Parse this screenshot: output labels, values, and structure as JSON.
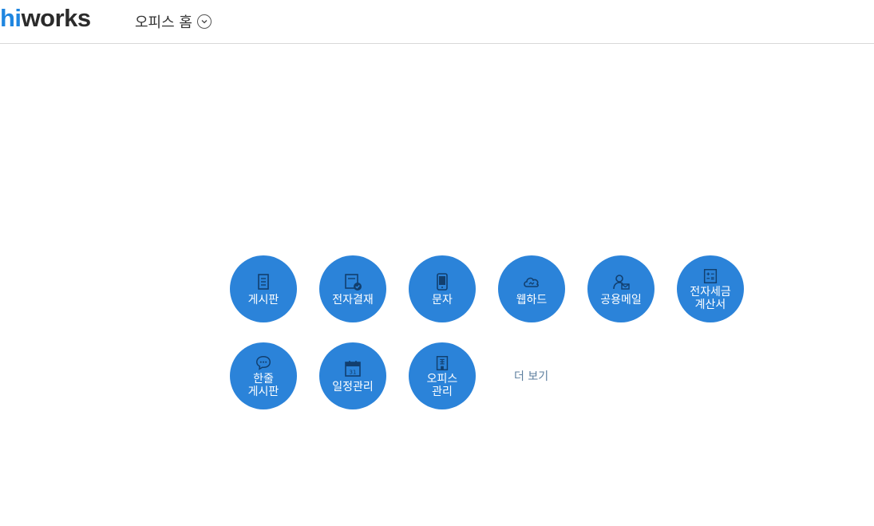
{
  "header": {
    "logo_hi": "hi",
    "logo_rest": "works",
    "office_home_label": "오피스 홈"
  },
  "apps": [
    {
      "label": "게시판",
      "icon": "document-icon"
    },
    {
      "label": "전자결재",
      "icon": "approval-icon"
    },
    {
      "label": "문자",
      "icon": "mobile-icon"
    },
    {
      "label": "웹하드",
      "icon": "cloud-icon"
    },
    {
      "label": "공용메일",
      "icon": "shared-mail-icon"
    },
    {
      "label": "전자세금\n계산서",
      "icon": "calculator-icon"
    },
    {
      "label": "한줄\n게시판",
      "icon": "chat-bubble-icon"
    },
    {
      "label": "일정관리",
      "icon": "calendar-icon"
    },
    {
      "label": "오피스\n관리",
      "icon": "building-icon"
    }
  ],
  "more_label": "더 보기",
  "colors": {
    "accent": "#2b83d9",
    "logo_hi": "#1f86e0",
    "more_link": "#5c7e9e"
  }
}
